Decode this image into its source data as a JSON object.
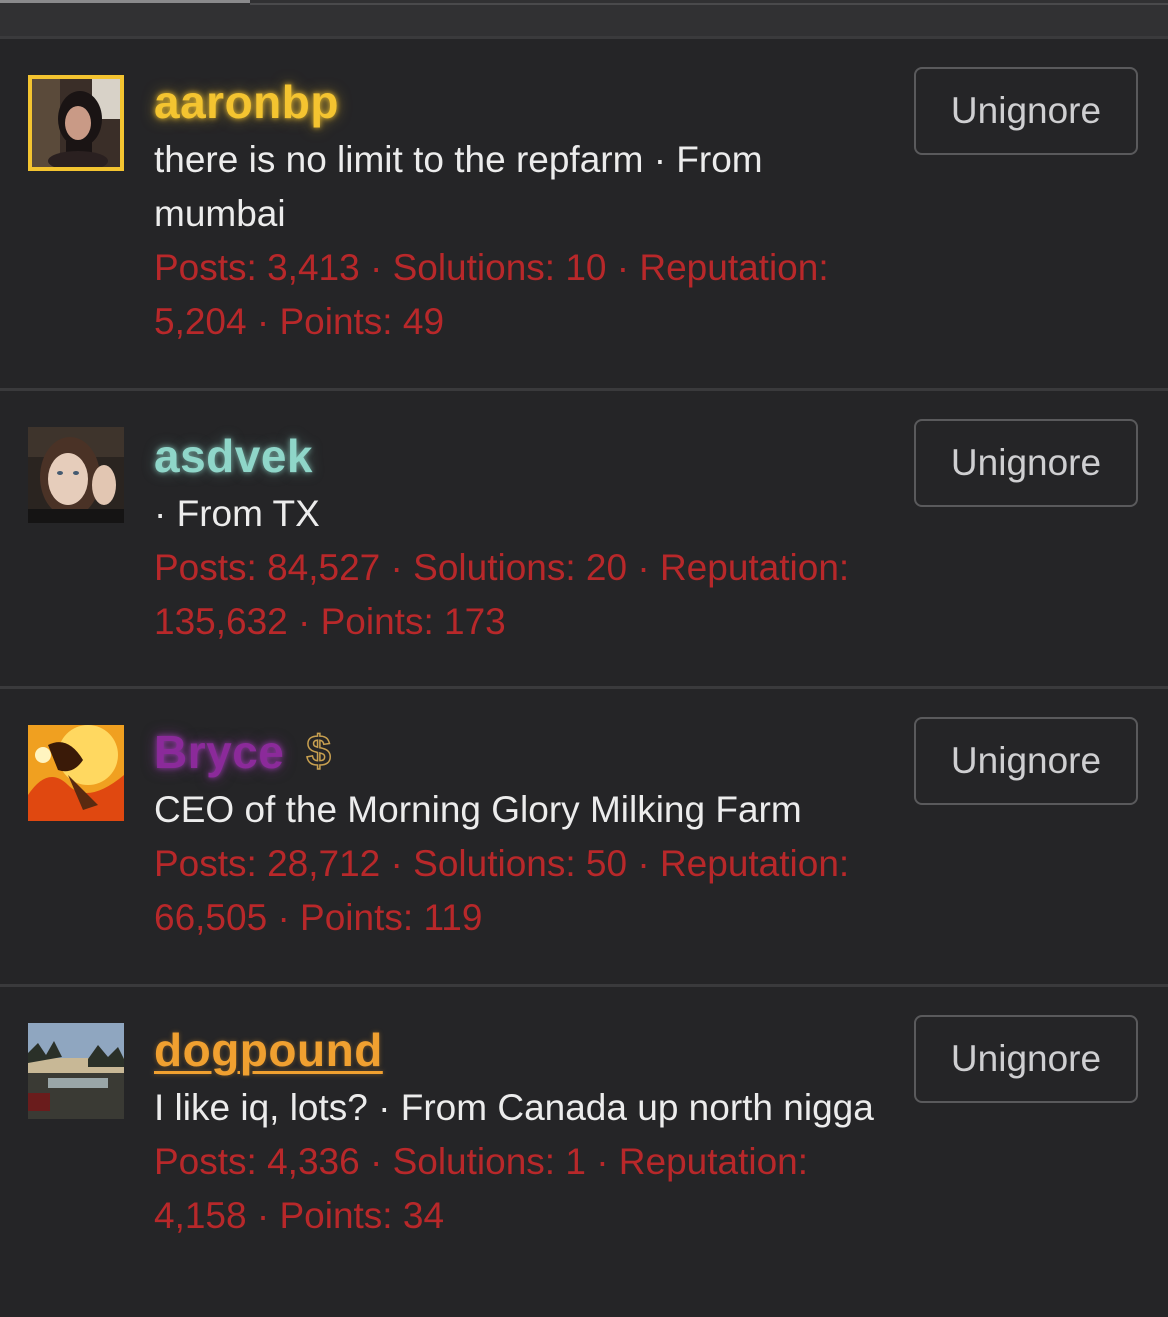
{
  "ignored_users": [
    {
      "username": "aaronbp",
      "bio": "there is no limit to the repfarm · From mumbai",
      "stats": "Posts: 3,413 · Solutions: 10 · Reputation: 5,204 · Points: 49",
      "button_label": "Unignore"
    },
    {
      "username": "asdvek",
      "bio": "· From TX",
      "stats": "Posts: 84,527 · Solutions: 20 · Reputation: 135,632 · Points: 173",
      "button_label": "Unignore"
    },
    {
      "username": "Bryce",
      "badge": "$",
      "bio": "CEO of the Morning Glory Milking Farm",
      "stats": "Posts: 28,712 · Solutions: 50 · Reputation: 66,505 · Points: 119",
      "button_label": "Unignore"
    },
    {
      "username": "dogpound",
      "bio": "I like iq, lots? · From Canada up north nigga",
      "stats": "Posts: 4,336 · Solutions: 1 · Reputation: 4,158 · Points: 34",
      "button_label": "Unignore"
    }
  ],
  "colors": {
    "background": "#252527",
    "stats_red": "#b8282a",
    "aaronbp_gold": "#f4c430",
    "asdvek_teal": "#8fd6c9",
    "bryce_purple": "#8b2a9a",
    "dogpound_orange": "#f0a030"
  }
}
